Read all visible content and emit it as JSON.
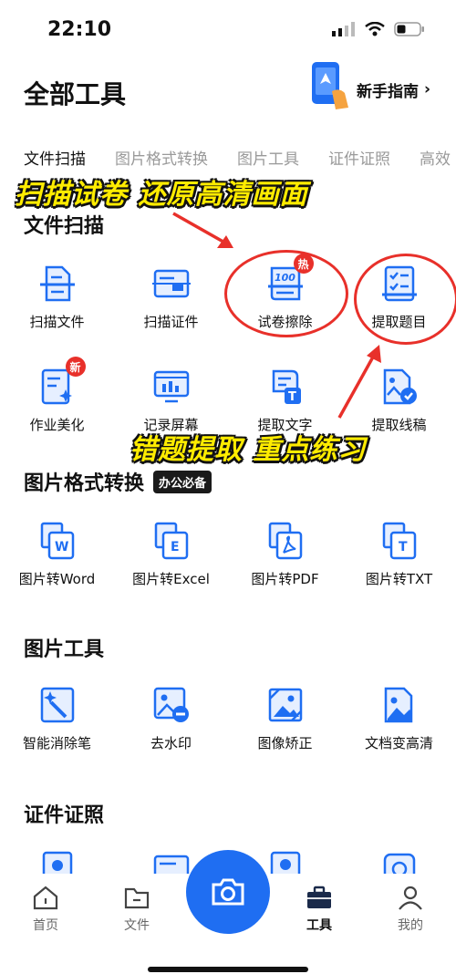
{
  "status": {
    "time": "22:10"
  },
  "header": {
    "title": "全部工具",
    "guide_label": "新手指南",
    "guide_chevron": "›"
  },
  "tabs": [
    {
      "label": "文件扫描"
    },
    {
      "label": "图片格式转换"
    },
    {
      "label": "图片工具"
    },
    {
      "label": "证件证照"
    },
    {
      "label": "高效"
    }
  ],
  "overlays": {
    "top": "扫描试卷 还原高清画面",
    "middle": "错题提取 重点练习"
  },
  "sections": {
    "scan": {
      "title": "文件扫描",
      "tools": [
        {
          "label": "扫描文件",
          "icon": "scan-doc-icon"
        },
        {
          "label": "扫描证件",
          "icon": "scan-id-icon"
        },
        {
          "label": "试卷擦除",
          "icon": "exam-erase-icon",
          "badge": "热"
        },
        {
          "label": "提取题目",
          "icon": "extract-question-icon"
        },
        {
          "label": "作业美化",
          "icon": "homework-icon",
          "badge": "新"
        },
        {
          "label": "记录屏幕",
          "icon": "screen-record-icon"
        },
        {
          "label": "提取文字",
          "icon": "extract-text-icon"
        },
        {
          "label": "提取线稿",
          "icon": "extract-lineart-icon"
        }
      ]
    },
    "format": {
      "title": "图片格式转换",
      "badge": "办公必备",
      "tools": [
        {
          "label": "图片转Word",
          "icon": "to-word-icon",
          "letter": "W"
        },
        {
          "label": "图片转Excel",
          "icon": "to-excel-icon",
          "letter": "E"
        },
        {
          "label": "图片转PDF",
          "icon": "to-pdf-icon",
          "letter": "⟆"
        },
        {
          "label": "图片转TXT",
          "icon": "to-txt-icon",
          "letter": "T"
        }
      ]
    },
    "image": {
      "title": "图片工具",
      "tools": [
        {
          "label": "智能消除笔",
          "icon": "magic-eraser-icon"
        },
        {
          "label": "去水印",
          "icon": "remove-watermark-icon"
        },
        {
          "label": "图像矫正",
          "icon": "image-correct-icon"
        },
        {
          "label": "文档变高清",
          "icon": "doc-hd-icon"
        }
      ]
    },
    "id": {
      "title": "证件证照"
    }
  },
  "bottom_nav": [
    {
      "label": "首页",
      "icon": "home-icon"
    },
    {
      "label": "文件",
      "icon": "folder-icon"
    },
    {
      "label": "工具",
      "icon": "toolbox-icon",
      "active": true
    },
    {
      "label": "我的",
      "icon": "profile-icon"
    }
  ],
  "colors": {
    "brand_blue": "#1f6ef2",
    "badge_red": "#e8302a",
    "annotation_yellow": "#ffec00"
  }
}
